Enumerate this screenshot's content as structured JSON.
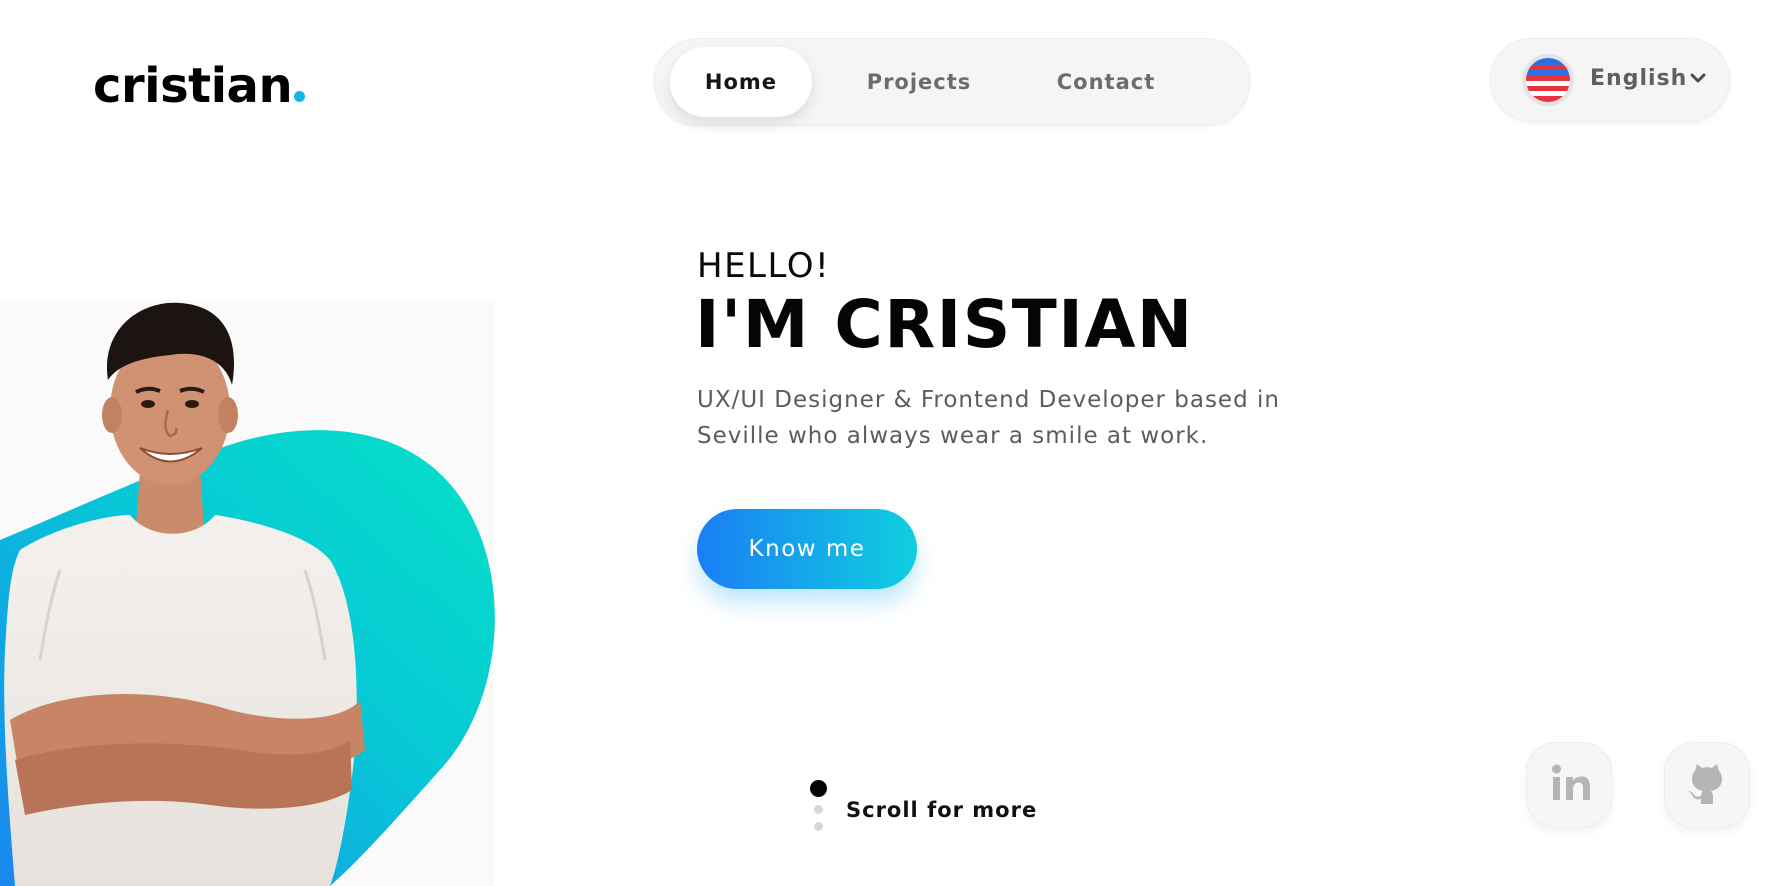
{
  "logo": {
    "text": "cristian"
  },
  "nav": {
    "items": [
      "Home",
      "Projects",
      "Contact"
    ],
    "active": "Home"
  },
  "language": {
    "label": "English",
    "flag": "us-flag-icon"
  },
  "hero": {
    "greeting": "HELLO!",
    "headline": "I'M CRISTIAN",
    "description": "UX/UI Designer & Frontend Developer based in Seville who always wear a smile at work.",
    "cta_label": "Know me"
  },
  "scroll": {
    "label": "Scroll for more"
  },
  "social": {
    "icons": [
      "linkedin-icon",
      "github-icon"
    ]
  },
  "colors": {
    "accent": "#14b6e6",
    "gradient_start": "#1b7ef5",
    "gradient_end": "#0fd0e0",
    "blob_teal": "#06dcc9",
    "blob_blue": "#1a86f0"
  }
}
